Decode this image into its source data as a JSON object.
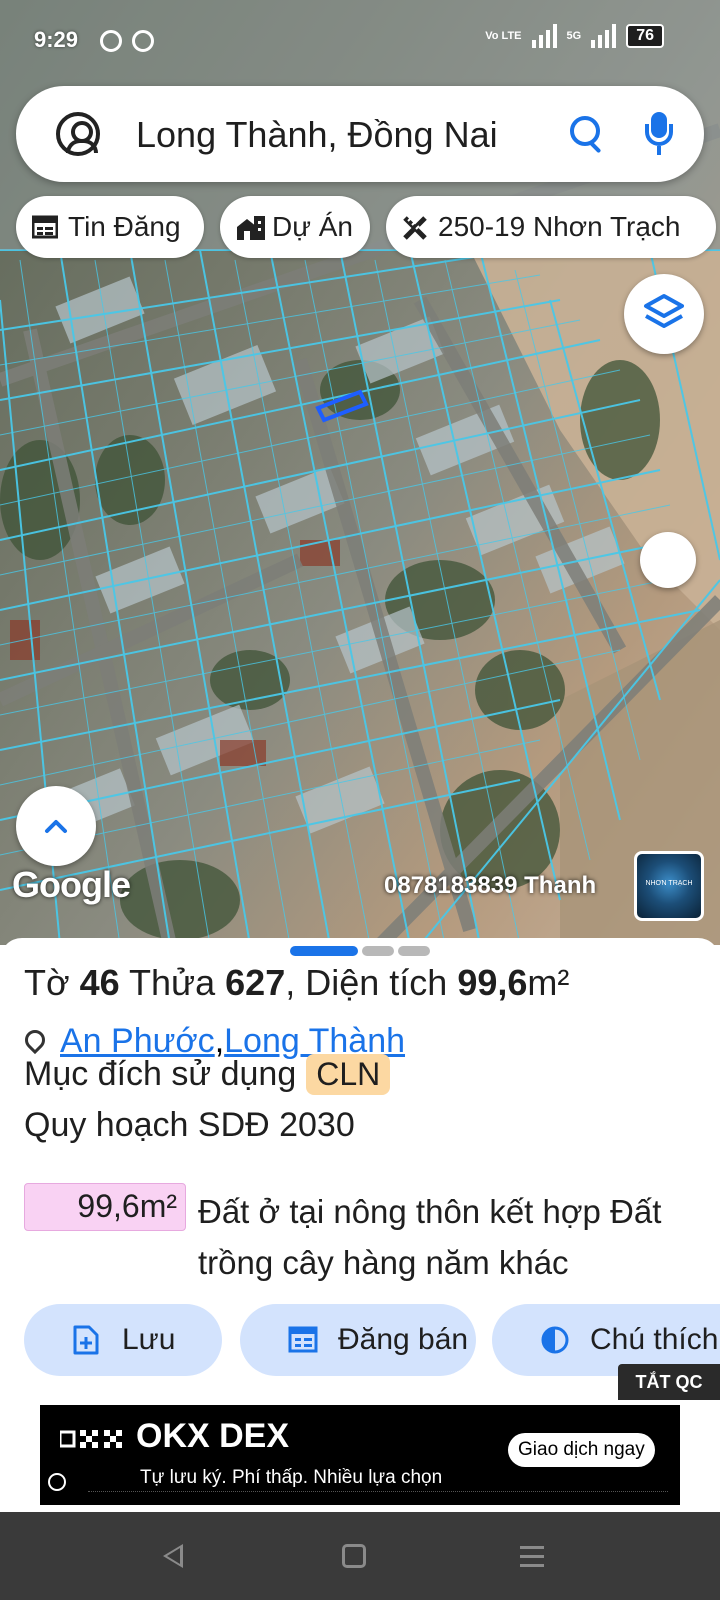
{
  "status_bar": {
    "time": "9:29",
    "network_label": "Vo LTE",
    "network_label_2": "5G",
    "battery": "76"
  },
  "search": {
    "query": "Long Thành, Đồng Nai"
  },
  "chips": [
    {
      "label": "Tin Đăng",
      "icon": "listing-icon"
    },
    {
      "label": "Dự Án",
      "icon": "buildings-icon"
    },
    {
      "label": "250-19 Nhơn Trạch",
      "icon": "ruler-pencil-icon"
    }
  ],
  "map": {
    "logo_text": "Google",
    "watermark_text": "0878183839 Thanh",
    "thumbnail_label": "NHƠN TRẠCH"
  },
  "parcel": {
    "sheet_prefix": "Tờ ",
    "sheet_no": "46",
    "lot_prefix": " Thửa ",
    "lot_no": "627",
    "area_prefix": ", Diện tích ",
    "area_value": "99,6",
    "area_unit": "m²",
    "ward": "An Phước",
    "separator": ", ",
    "district": "Long Thành",
    "purpose_label": "Mục đích sử dụng",
    "purpose_code": "CLN",
    "plan_label": "Quy hoạch SDĐ 2030",
    "plan_area": "99,6m²",
    "plan_desc": "Đất ở tại nông thôn kết hợp Đất trồng cây hàng năm khác"
  },
  "actions": [
    {
      "label": "Lưu",
      "icon": "save-icon"
    },
    {
      "label": "Đăng bán",
      "icon": "calendar-icon"
    },
    {
      "label": "Chú thích",
      "icon": "legend-icon"
    }
  ],
  "ad": {
    "close_label": "TẮT QC",
    "brand": "OKX DEX",
    "subtitle": "Tự lưu ký. Phí thấp. Nhiều lựa chọn",
    "cta": "Giao dịch ngay"
  },
  "colors": {
    "accent": "#1a73e8",
    "chip_bg": "#d3e3fd",
    "badge_bg": "#fcd8a2",
    "area_bg": "#f9d2f3",
    "parcel_lines": "#49c8e8"
  }
}
